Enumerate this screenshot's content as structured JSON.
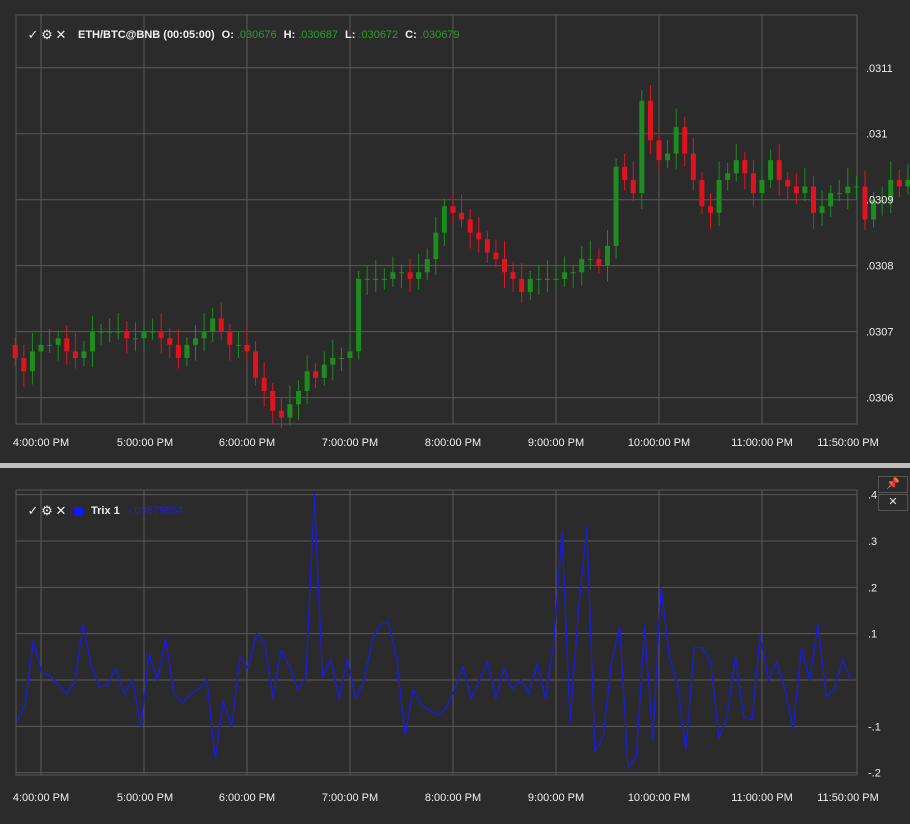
{
  "main_chart": {
    "legend": {
      "symbol": "ETH/BTC@BNB (00:05:00)",
      "open_label": "O:",
      "open_value": ".030676",
      "high_label": "H:",
      "high_value": ".030687",
      "low_label": "L:",
      "low_value": ".030672",
      "close_label": "C:",
      "close_value": ".030679"
    },
    "icons": [
      "check-icon",
      "gear-icon",
      "close-icon"
    ],
    "up_color": "#1e8c1e",
    "down_color": "#e0141e"
  },
  "indicator": {
    "legend": {
      "name": "Trix 1",
      "value": "-.03879854"
    },
    "line_color": "#1c1cd6",
    "pane_buttons": {
      "pin": "📌",
      "close": "✕"
    }
  },
  "chart_data": [
    {
      "type": "candlestick",
      "title": "ETH/BTC@BNB (00:05:00)",
      "x_tick_labels": [
        "4:00:00 PM",
        "5:00:00 PM",
        "6:00:00 PM",
        "7:00:00 PM",
        "8:00:00 PM",
        "9:00:00 PM",
        "10:00:00 PM",
        "11:00:00 PM",
        "11:50:00 PM"
      ],
      "y_tick_labels": [
        ".0306",
        ".0307",
        ".0308",
        ".0309",
        ".031",
        ".0311"
      ],
      "ylim": [
        0.03056,
        0.03118
      ],
      "x_range_hours": [
        15.75,
        23.97
      ],
      "grid": true,
      "bar_interval_minutes": 5,
      "start_time": "3:45:00 PM",
      "close": [
        0.03066,
        0.03064,
        0.03067,
        0.03068,
        0.03068,
        0.03069,
        0.03067,
        0.03066,
        0.03067,
        0.0307,
        0.0307,
        0.0307,
        0.0307,
        0.03069,
        0.03069,
        0.0307,
        0.0307,
        0.03069,
        0.03068,
        0.03066,
        0.03068,
        0.03069,
        0.0307,
        0.03072,
        0.0307,
        0.03068,
        0.03068,
        0.03067,
        0.03063,
        0.03061,
        0.03058,
        0.03057,
        0.03059,
        0.03061,
        0.03064,
        0.03063,
        0.03065,
        0.03066,
        0.03066,
        0.03067,
        0.03078,
        0.03078,
        0.03078,
        0.03078,
        0.03079,
        0.03079,
        0.03078,
        0.03079,
        0.03081,
        0.03085,
        0.03089,
        0.03088,
        0.03087,
        0.03085,
        0.03084,
        0.03082,
        0.03081,
        0.03079,
        0.03078,
        0.03076,
        0.03078,
        0.03078,
        0.03078,
        0.03078,
        0.03079,
        0.03079,
        0.03081,
        0.03081,
        0.0308,
        0.03083,
        0.03095,
        0.03093,
        0.03091,
        0.03105,
        0.03099,
        0.03096,
        0.03097,
        0.03101,
        0.03097,
        0.03093,
        0.03089,
        0.03088,
        0.03093,
        0.03094,
        0.03096,
        0.03094,
        0.03091,
        0.03093,
        0.03096,
        0.03093,
        0.03092,
        0.03091,
        0.03092,
        0.03088,
        0.03089,
        0.03091,
        0.03091,
        0.03092,
        0.03092,
        0.03087,
        0.0309,
        0.0309,
        0.03093,
        0.03092,
        0.03093
      ],
      "series": [
        {
          "name": "ETH/BTC@BNB"
        }
      ]
    },
    {
      "type": "line",
      "title": "Trix 1",
      "series": [
        {
          "name": "Trix 1",
          "values": [
            -0.09,
            -0.05,
            0.085,
            0.015,
            0.01,
            -0.01,
            -0.03,
            -0.005,
            0.12,
            0.03,
            -0.015,
            -0.01,
            0.025,
            -0.03,
            0.0,
            -0.1,
            0.055,
            0.0,
            0.09,
            -0.03,
            -0.05,
            -0.03,
            -0.02,
            0.0,
            -0.17,
            -0.045,
            -0.1,
            0.05,
            0.025,
            0.1,
            0.08,
            -0.04,
            0.065,
            0.03,
            -0.02,
            0.005,
            0.4,
            0.005,
            0.045,
            -0.04,
            0.045,
            -0.04,
            -0.005,
            0.085,
            0.12,
            0.125,
            0.045,
            -0.12,
            -0.02,
            -0.055,
            -0.065,
            -0.075,
            -0.06,
            -0.02,
            0.03,
            -0.04,
            0.0,
            0.04,
            -0.04,
            0.025,
            -0.02,
            0.0,
            -0.03,
            0.035,
            -0.04,
            0.08,
            0.32,
            -0.09,
            0.15,
            0.33,
            -0.155,
            -0.12,
            0.04,
            0.115,
            -0.19,
            -0.165,
            0.115,
            -0.13,
            0.2,
            0.05,
            -0.01,
            -0.15,
            0.07,
            0.07,
            0.04,
            -0.125,
            -0.08,
            0.05,
            -0.08,
            -0.085,
            0.095,
            0.0,
            0.04,
            -0.02,
            -0.105,
            0.07,
            0.0,
            0.12,
            -0.035,
            -0.02,
            0.045,
            0.0
          ]
        }
      ],
      "x_tick_labels": [
        "4:00:00 PM",
        "5:00:00 PM",
        "6:00:00 PM",
        "7:00:00 PM",
        "8:00:00 PM",
        "9:00:00 PM",
        "10:00:00 PM",
        "11:00:00 PM",
        "11:50:00 PM"
      ],
      "y_tick_labels": [
        ".4",
        ".3",
        ".2",
        ".1",
        "-.1",
        "-.2"
      ],
      "ylim": [
        -0.205,
        0.41
      ],
      "grid": true
    }
  ]
}
